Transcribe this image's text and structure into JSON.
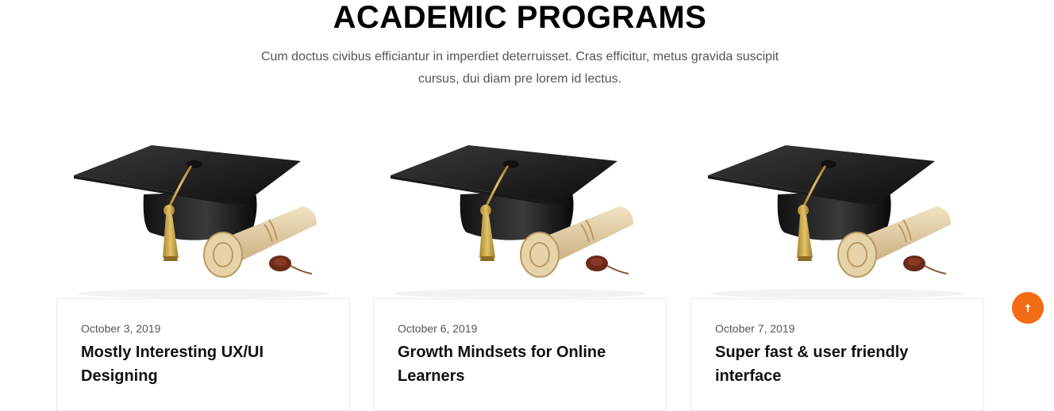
{
  "section": {
    "title": "ACADEMIC PROGRAMS",
    "subtitle": "Cum doctus civibus efficiantur in imperdiet deterruisset. Cras efficitur, metus gravida suscipit cursus, dui diam pre lorem id lectus."
  },
  "programs": [
    {
      "date": "October 3, 2019",
      "title": "Mostly Interesting UX/UI Designing",
      "image": "graduation-cap-diploma"
    },
    {
      "date": "October 6, 2019",
      "title": "Growth Mindsets for Online Learners",
      "image": "graduation-cap-diploma"
    },
    {
      "date": "October 7, 2019",
      "title": "Super fast & user friendly interface",
      "image": "graduation-cap-diploma"
    }
  ],
  "scroll_top": {
    "icon": "arrow-up-icon",
    "color": "#f36b12"
  },
  "colors": {
    "accent": "#f36b12",
    "card_border": "#e9e9e9",
    "subtitle": "#555555"
  }
}
